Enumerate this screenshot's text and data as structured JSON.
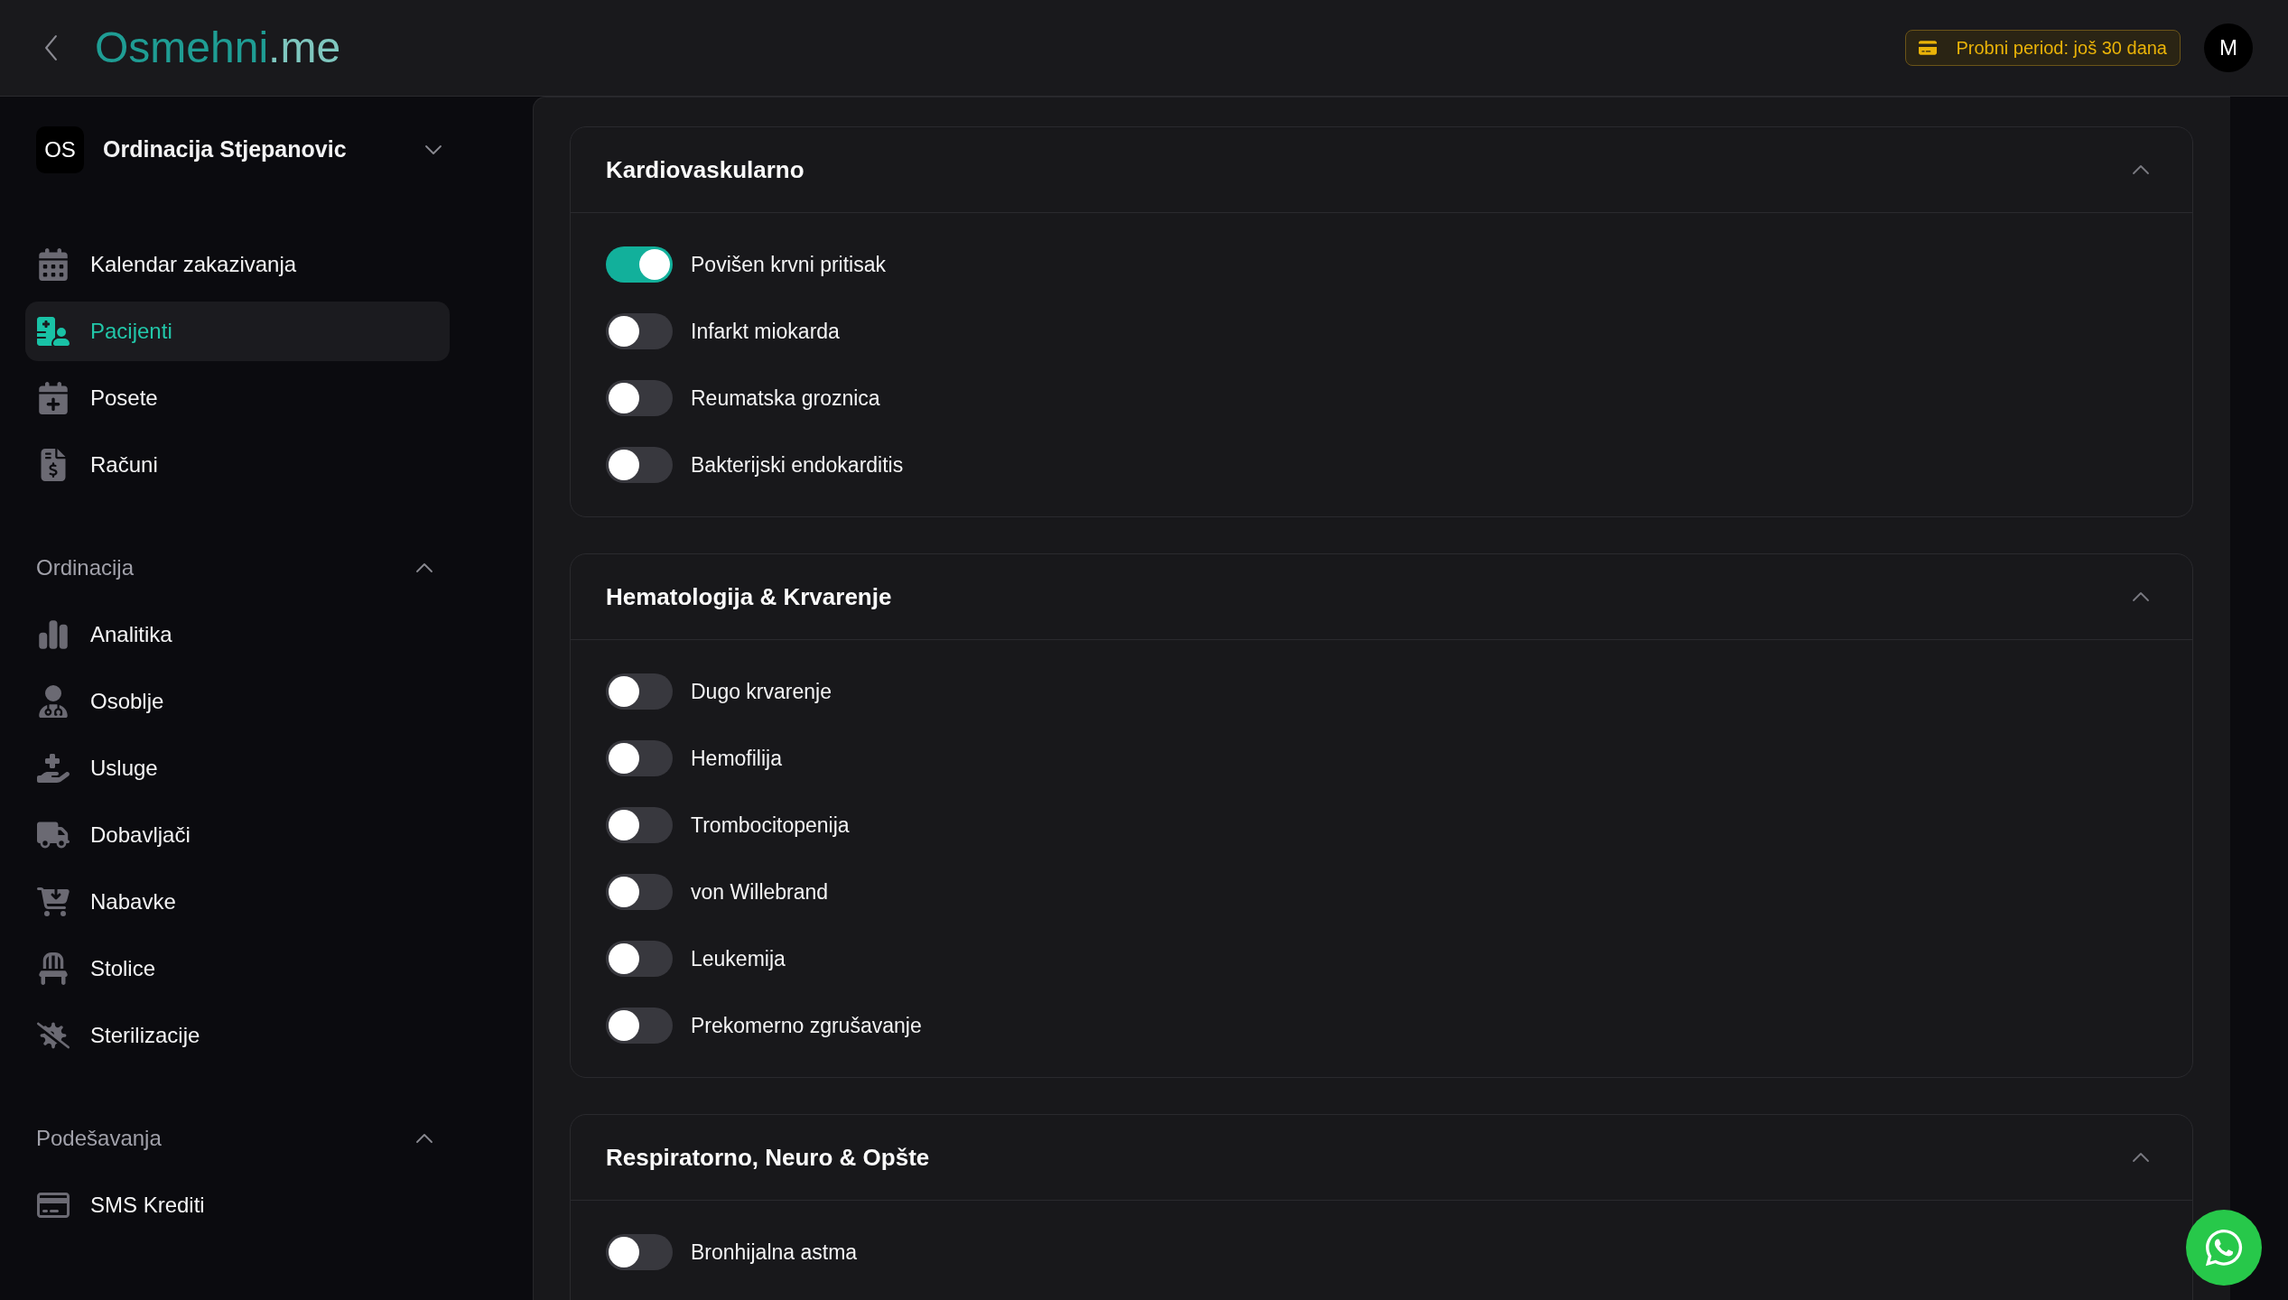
{
  "header": {
    "logo": {
      "name": "Osmehni",
      "suffix": ".me"
    },
    "trial_badge": "Probni period: još 30 dana",
    "avatar": "M"
  },
  "sidebar": {
    "org": {
      "initials": "OS",
      "name": "Ordinacija Stjepanovic"
    },
    "items": [
      {
        "label": "Kalendar zakazivanja",
        "selected": false
      },
      {
        "label": "Pacijenti",
        "selected": true
      },
      {
        "label": "Posete",
        "selected": false
      },
      {
        "label": "Računi",
        "selected": false
      }
    ],
    "sections": [
      {
        "title": "Ordinacija",
        "expanded": true,
        "items": [
          {
            "label": "Analitika",
            "selected": false
          },
          {
            "label": "Osoblje",
            "selected": false
          },
          {
            "label": "Usluge",
            "selected": false
          },
          {
            "label": "Dobavljači",
            "selected": false
          },
          {
            "label": "Nabavke",
            "selected": false
          },
          {
            "label": "Stolice",
            "selected": false
          },
          {
            "label": "Sterilizacije",
            "selected": false
          }
        ]
      },
      {
        "title": "Podešavanja",
        "expanded": true,
        "items": [
          {
            "label": "SMS Krediti",
            "selected": false
          }
        ]
      }
    ]
  },
  "sections": [
    {
      "title": "Kardiovaskularno",
      "expanded": true,
      "items": [
        {
          "label": "Povišen krvni pritisak",
          "on": true
        },
        {
          "label": "Infarkt miokarda",
          "on": false
        },
        {
          "label": "Reumatska groznica",
          "on": false
        },
        {
          "label": "Bakterijski endokarditis",
          "on": false
        }
      ]
    },
    {
      "title": "Hematologija & Krvarenje",
      "expanded": true,
      "items": [
        {
          "label": "Dugo krvarenje",
          "on": false
        },
        {
          "label": "Hemofilija",
          "on": false
        },
        {
          "label": "Trombocitopenija",
          "on": false
        },
        {
          "label": "von Willebrand",
          "on": false
        },
        {
          "label": "Leukemija",
          "on": false
        },
        {
          "label": "Prekomerno zgrušavanje",
          "on": false
        }
      ]
    },
    {
      "title": "Respiratorno, Neuro & Opšte",
      "expanded": true,
      "items": [
        {
          "label": "Bronhijalna astma",
          "on": false
        }
      ]
    }
  ]
}
